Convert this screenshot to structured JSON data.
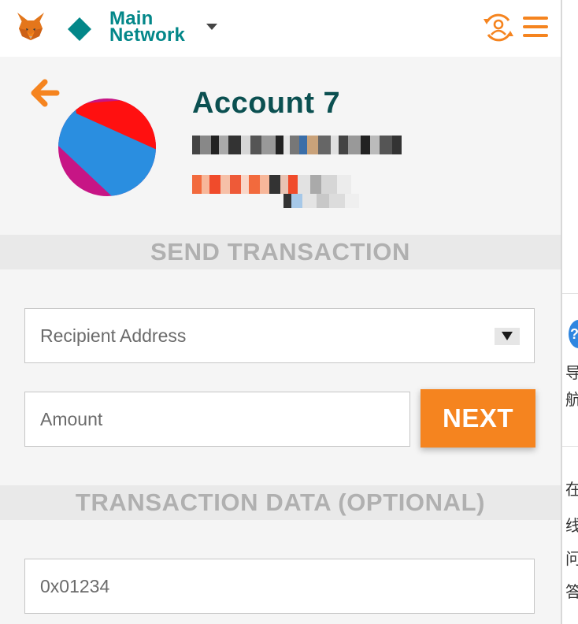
{
  "header": {
    "network_name": "Main Network",
    "icons": [
      "metamask-fox-icon",
      "network-diamond-icon",
      "account-switch-icon",
      "hamburger-menu-icon"
    ]
  },
  "account": {
    "name": "Account 7"
  },
  "send": {
    "section_title": "SEND TRANSACTION",
    "recipient_placeholder": "Recipient Address",
    "amount_placeholder": "Amount",
    "next_label": "NEXT"
  },
  "data": {
    "section_title": "TRANSACTION DATA (OPTIONAL)",
    "hex_placeholder": "0x01234"
  },
  "colors": {
    "accent": "#f5841f",
    "network": "#038789",
    "account_name": "#0b5051",
    "section_text": "#b0b0b0",
    "section_band": "#e9e9e9",
    "background": "#f5f5f5"
  },
  "background_window": {
    "visible_chars": [
      "?",
      "导",
      "航",
      "在",
      "线",
      "问",
      "答"
    ]
  }
}
